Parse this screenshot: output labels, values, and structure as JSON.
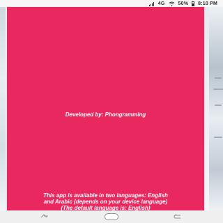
{
  "status_bar": {
    "signal_text": "4G",
    "battery_percent": "50%",
    "time": "8:10 PM"
  },
  "panel": {
    "background_color": "#e9285f",
    "developer_text": "Developed by: Phongramming",
    "notice_lines": [
      "This app is available in two languages: English",
      "and Arabic (depends on your device language)",
      "(The default language is: English)"
    ]
  },
  "icons": {
    "signal": "signal-icon",
    "wifi": "wifi-icon",
    "battery": "battery-icon",
    "recents": "recents-icon",
    "home": "home-icon",
    "back": "back-icon"
  }
}
